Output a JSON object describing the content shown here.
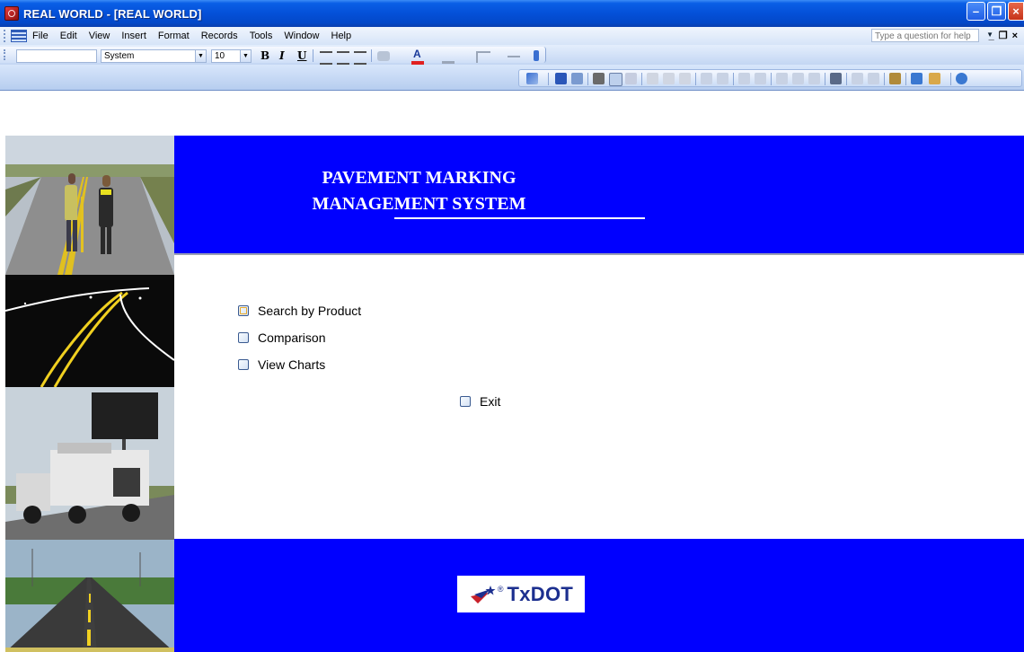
{
  "window": {
    "title": "REAL WORLD - [REAL WORLD]"
  },
  "menubar": {
    "items": [
      "File",
      "Edit",
      "View",
      "Insert",
      "Format",
      "Records",
      "Tools",
      "Window",
      "Help"
    ],
    "help_placeholder": "Type a question for help"
  },
  "formatting_toolbar": {
    "object_combo_value": "",
    "font_combo_value": "System",
    "size_combo_value": "10",
    "bold_label": "B",
    "italic_label": "I",
    "underline_label": "U"
  },
  "form": {
    "title_line1": "PAVEMENT MARKING",
    "title_line2": "MANAGEMENT SYSTEM",
    "options": [
      {
        "label": "Search by Product"
      },
      {
        "label": "Comparison"
      },
      {
        "label": "View Charts"
      }
    ],
    "exit_label": "Exit",
    "logo_text": "TxDOT",
    "logo_mark": "®"
  },
  "colors": {
    "form_band": "#0000ff",
    "titlebar": "#0450d8",
    "logo_text": "#1c2f8f"
  },
  "photos": [
    "two-workers-inspecting-road-icon",
    "night-road-markings-icon",
    "striping-truck-icon",
    "highway-centerline-icon"
  ]
}
